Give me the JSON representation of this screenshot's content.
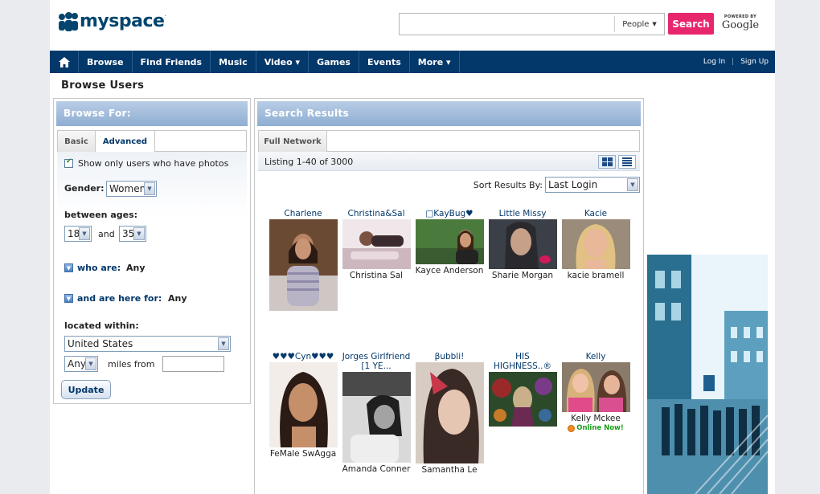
{
  "header": {
    "logo_text": "myspace",
    "logo_tm": ".",
    "search_placeholder": "",
    "search_scope": "People",
    "search_button": "Search",
    "powered_by": "POWERED BY",
    "powered_brand": "Google"
  },
  "nav": {
    "items": [
      {
        "label": "Browse",
        "has_menu": false
      },
      {
        "label": "Find Friends",
        "has_menu": false
      },
      {
        "label": "Music",
        "has_menu": false
      },
      {
        "label": "Video ▾",
        "has_menu": true
      },
      {
        "label": "Games",
        "has_menu": false
      },
      {
        "label": "Events",
        "has_menu": false
      },
      {
        "label": "More ▾",
        "has_menu": true
      }
    ],
    "login": "Log In",
    "sep": "|",
    "signup": "Sign Up"
  },
  "page_title": "Browse Users",
  "browse_for": {
    "heading": "Browse For:",
    "tab_basic": "Basic",
    "tab_advanced": "Advanced",
    "photos_checkbox": "Show only users who have photos",
    "photos_checked": true,
    "gender_label": "Gender:",
    "gender_value": "Women",
    "ages_label": "between ages:",
    "age_min": "18",
    "age_and": "and",
    "age_max": "35",
    "who_are_label": "who are:",
    "who_are_value": "Any",
    "here_for_label": "and are here for:",
    "here_for_value": "Any",
    "located_label": "located within:",
    "country": "United States",
    "miles_value": "Any",
    "miles_from": "miles from",
    "zip_value": "",
    "update_button": "Update"
  },
  "results": {
    "heading": "Search Results",
    "tab_full": "Full Network",
    "listing": "Listing 1-40 of 3000",
    "sort_label": "Sort Results By:",
    "sort_value": "Last Login",
    "users": [
      {
        "name": "Charlene",
        "real": "",
        "online": false
      },
      {
        "name": "Christina&Sal",
        "real": "Christina Sal",
        "online": false
      },
      {
        "name": "□KayBug♥",
        "real": "Kayce Anderson",
        "online": false
      },
      {
        "name": "Little Missy",
        "real": "Sharie Morgan",
        "online": false
      },
      {
        "name": "Kacie",
        "real": "kacie bramell",
        "online": false
      },
      {
        "name": "♥♥♥Cyn♥♥♥",
        "real": "FeMale SwAgga",
        "online": false
      },
      {
        "name": "Jorges Girlfriend [1 YE...",
        "real": "Amanda Conner",
        "online": false
      },
      {
        "name": "βubbli!",
        "real": "Samantha Le",
        "online": false
      },
      {
        "name": "HIS HIGHNESS..®",
        "real": "",
        "online": false
      },
      {
        "name": "Kelly",
        "real": "Kelly Mckee",
        "online": true
      }
    ],
    "online_now": "Online Now!"
  },
  "colors": {
    "brand_blue": "#03386b",
    "search_pink": "#e8266e",
    "online_green": "#19a019"
  }
}
